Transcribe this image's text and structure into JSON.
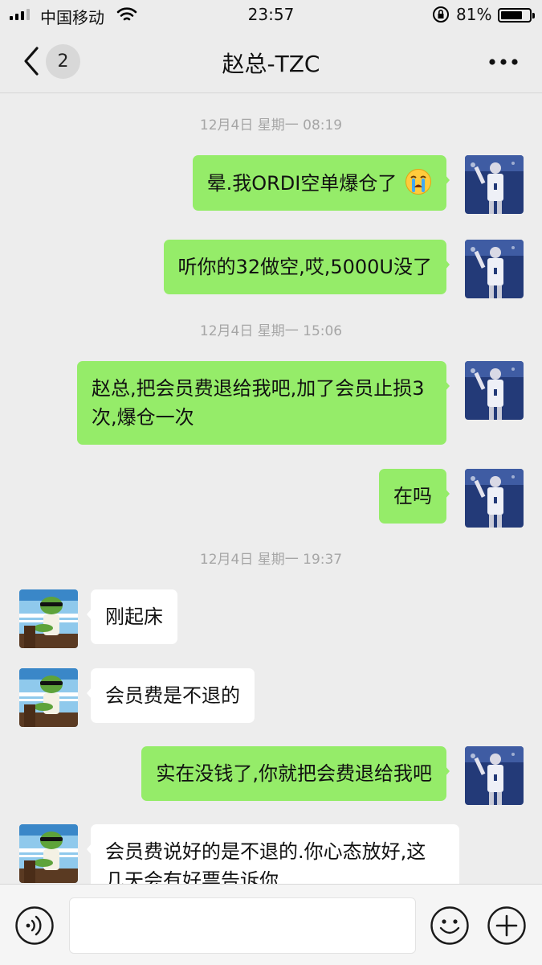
{
  "status_bar": {
    "carrier": "中国移动",
    "time": "23:57",
    "battery": "81%",
    "battery_level": 0.81
  },
  "nav": {
    "unread_count": "2",
    "title": "赵总-TZC"
  },
  "messages": {
    "stamp_1": "12月4日 星期一 08:19",
    "m1": "晕.我ORDI空单爆仓了",
    "m2": "听你的32做空,哎,5000U没了",
    "stamp_2": "12月4日 星期一 15:06",
    "m3": "赵总,把会员费退给我吧,加了会员止损3次,爆仓一次",
    "m4": "在吗",
    "stamp_3": "12月4日 星期一 19:37",
    "m5": "刚起床",
    "m6": "会员费是不退的",
    "m7": "实在没钱了,你就把会费退给我吧",
    "m8": "会员费说好的是不退的.你心态放好,这几天会有好票告诉你"
  },
  "colors": {
    "sent_bubble": "#95ec69",
    "received_bubble": "#ffffff",
    "background": "#ededed"
  },
  "icons": {
    "back": "chevron-left-icon",
    "more": "more-dots-icon",
    "voice": "voice-icon",
    "emoji": "emoji-icon",
    "plus": "plus-icon",
    "crying": "crying-emoji-icon"
  }
}
